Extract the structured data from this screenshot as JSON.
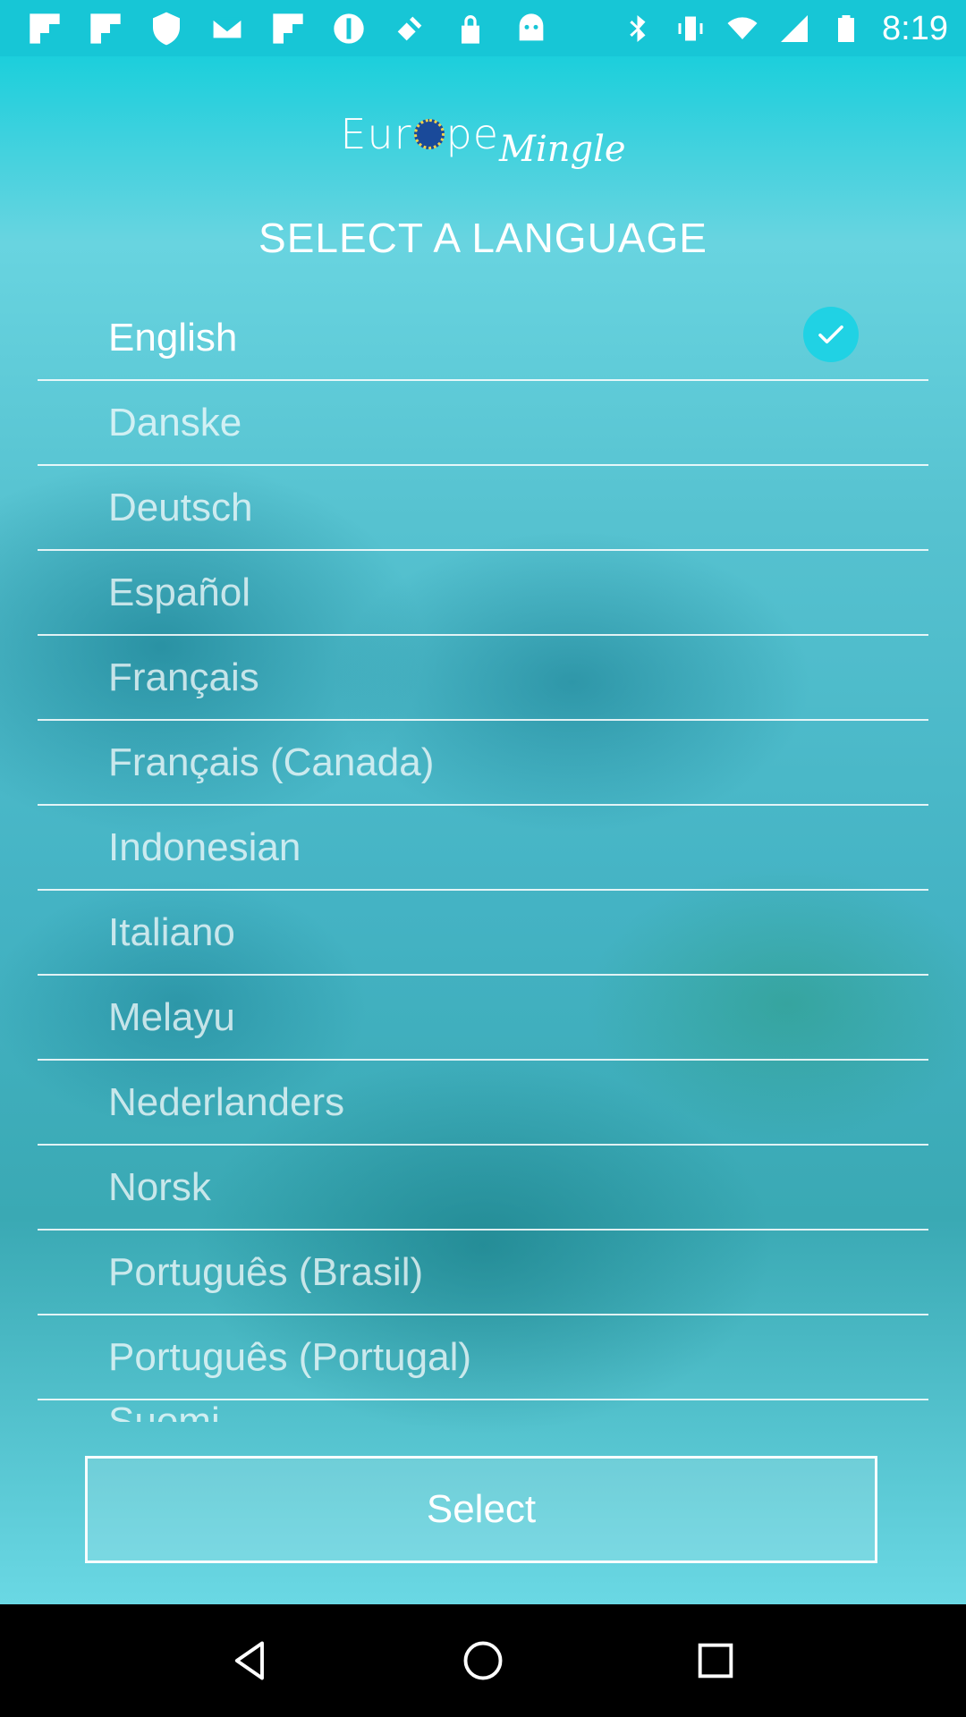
{
  "status_bar": {
    "time": "8:19",
    "left_icons": [
      "flipboard-icon",
      "flipboard-icon",
      "shield-icon",
      "mail-icon",
      "flipboard-icon",
      "bolt-circle-icon",
      "satellite-icon",
      "lock-icon",
      "android-icon"
    ],
    "right_icons": [
      "bluetooth-icon",
      "vibrate-icon",
      "wifi-icon",
      "signal-icon",
      "battery-icon"
    ]
  },
  "app": {
    "logo_main_left": "Eur",
    "logo_main_right": "pe",
    "logo_script": "Mingle",
    "heading": "SELECT A LANGUAGE",
    "languages": [
      {
        "label": "English",
        "selected": true
      },
      {
        "label": "Danske",
        "selected": false
      },
      {
        "label": "Deutsch",
        "selected": false
      },
      {
        "label": "Español",
        "selected": false
      },
      {
        "label": "Français",
        "selected": false
      },
      {
        "label": "Français (Canada)",
        "selected": false
      },
      {
        "label": "Indonesian",
        "selected": false
      },
      {
        "label": "Italiano",
        "selected": false
      },
      {
        "label": "Melayu",
        "selected": false
      },
      {
        "label": "Nederlanders",
        "selected": false
      },
      {
        "label": "Norsk",
        "selected": false
      },
      {
        "label": "Português (Brasil)",
        "selected": false
      },
      {
        "label": "Português (Portugal)",
        "selected": false
      }
    ],
    "partial_language": "Suomi",
    "select_button": "Select",
    "check_color": "#20d2e4"
  },
  "nav_bar": {
    "buttons": [
      "back-icon",
      "home-icon",
      "recents-icon"
    ]
  }
}
